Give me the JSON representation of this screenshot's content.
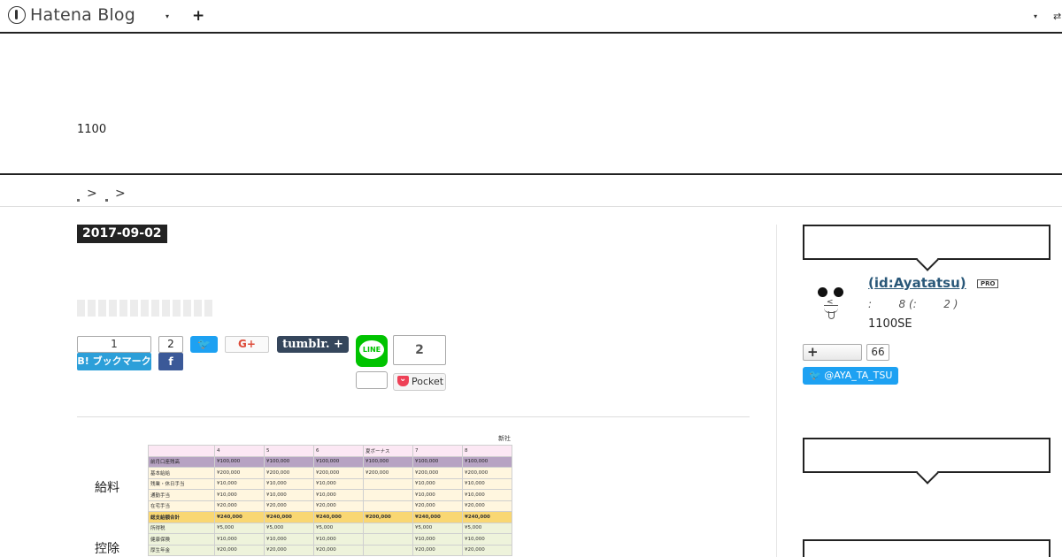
{
  "topbar": {
    "logo_text": "Hatena Blog",
    "caret": "▾",
    "plus": "+",
    "right_icon": "⇄"
  },
  "header": {
    "description": "1100"
  },
  "breadcrumb": {
    "items": [
      ">",
      ">"
    ]
  },
  "entry": {
    "date": "2017-09-02",
    "title_placeholder_blocks": 13
  },
  "share": {
    "hatena_count": "1",
    "hatena_label": "B! ブックマーク",
    "facebook_count": "2",
    "facebook_icon": "f",
    "twitter_icon": "🐦",
    "gplus_label": "G+",
    "tumblr_label": "tumblr. +",
    "line_label": "LINE",
    "line_count": "",
    "pocket_count": "2",
    "pocket_label": "Pocket"
  },
  "content": {
    "label_salary": "給料",
    "label_deduction": "控除",
    "sheet": {
      "corner": "新社",
      "header": [
        "",
        "4",
        "5",
        "6",
        "夏ボーナス",
        "7",
        "8"
      ],
      "rows": [
        {
          "style": "prev",
          "cells": [
            "前月口座残高",
            "¥100,000",
            "¥100,000",
            "¥100,000",
            "¥100,000",
            "¥100,000",
            "¥100,000"
          ]
        },
        {
          "style": "inc",
          "cells": [
            "基本給給",
            "¥200,000",
            "¥200,000",
            "¥200,000",
            "¥200,000",
            "¥200,000",
            "¥200,000"
          ]
        },
        {
          "style": "inc",
          "cells": [
            "残業・休日手当",
            "¥10,000",
            "¥10,000",
            "¥10,000",
            "",
            "¥10,000",
            "¥10,000"
          ]
        },
        {
          "style": "inc",
          "cells": [
            "通勤手当",
            "¥10,000",
            "¥10,000",
            "¥10,000",
            "",
            "¥10,000",
            "¥10,000"
          ]
        },
        {
          "style": "inc",
          "cells": [
            "在宅手当",
            "¥20,000",
            "¥20,000",
            "¥20,000",
            "",
            "¥20,000",
            "¥20,000"
          ]
        },
        {
          "style": "sum",
          "cells": [
            "総支給額合計",
            "¥240,000",
            "¥240,000",
            "¥240,000",
            "¥200,000",
            "¥240,000",
            "¥240,000"
          ]
        },
        {
          "style": "ded",
          "cells": [
            "所得税",
            "¥5,000",
            "¥5,000",
            "¥5,000",
            "",
            "¥5,000",
            "¥5,000"
          ]
        },
        {
          "style": "ded",
          "cells": [
            "健康保険",
            "¥10,000",
            "¥10,000",
            "¥10,000",
            "",
            "¥10,000",
            "¥10,000"
          ]
        },
        {
          "style": "ded",
          "cells": [
            "厚生年金",
            "¥20,000",
            "¥20,000",
            "¥20,000",
            "",
            "¥20,000",
            "¥20,000"
          ]
        }
      ]
    }
  },
  "sidebar": {
    "profile_name": " (id:Ayatatsu)",
    "pro_badge": "PRO",
    "profile_meta": ":        8 (:        2 )",
    "profile_desc": "1100SE",
    "follow_icon": "+",
    "follow_count": "66",
    "twitter_handle": "@AYA_TA_TSU"
  }
}
